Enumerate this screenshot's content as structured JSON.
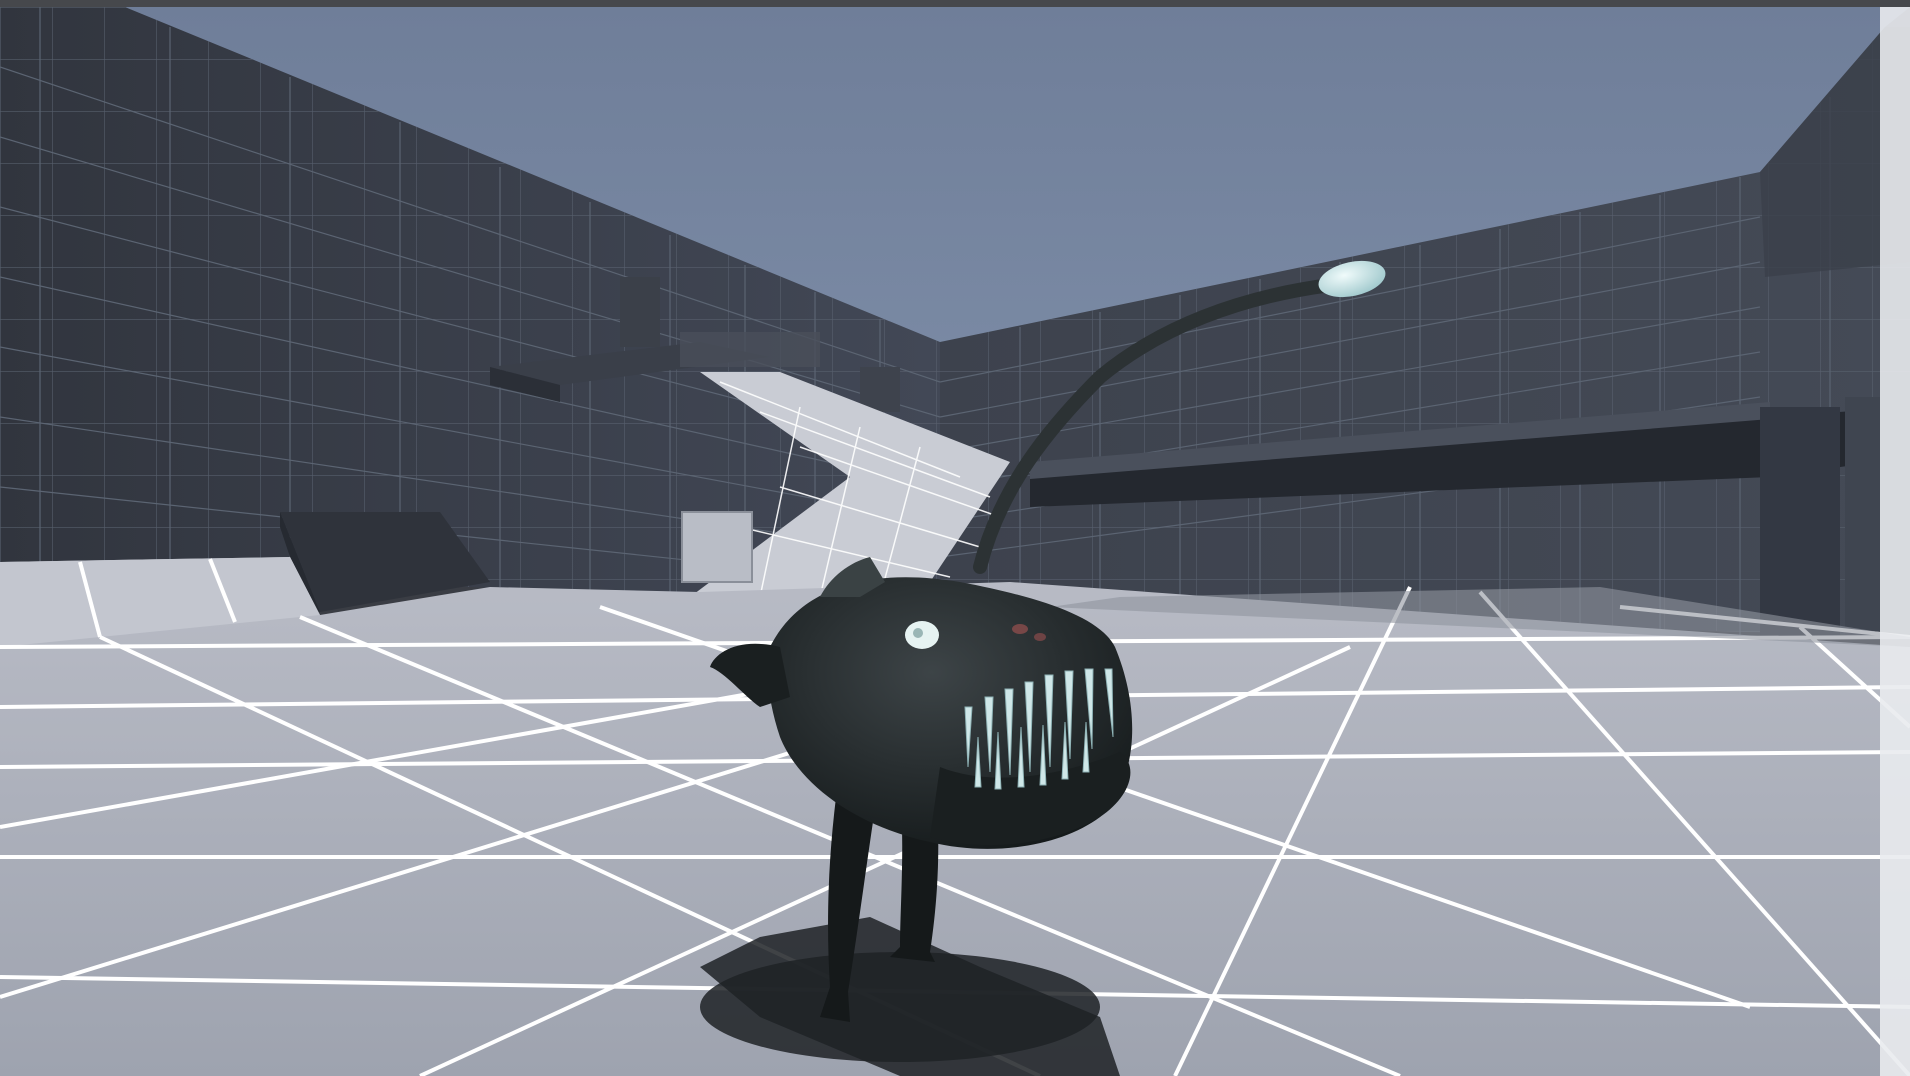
{
  "scene": {
    "subject_icon": "anglerfish-creature-icon",
    "colors": {
      "sky": "#7585a0",
      "wall_dark": "#343943",
      "wall_mid": "#454b57",
      "floor": "#a9adb8",
      "grid_line": "#ffffff",
      "creature_body": "#23282a",
      "creature_teeth": "#cfe7e8",
      "lure_bulb": "#cde3e6"
    }
  }
}
